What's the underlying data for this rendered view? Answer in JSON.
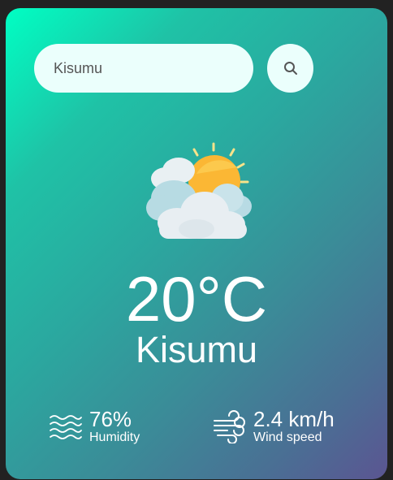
{
  "search": {
    "value": "Kisumu",
    "button_icon": "search-icon"
  },
  "weather": {
    "icon": "partly-cloudy-icon",
    "temperature": "20°C",
    "city": "Kisumu"
  },
  "details": {
    "humidity": {
      "icon": "humidity-waves-icon",
      "value": "76%",
      "label": "Humidity"
    },
    "wind": {
      "icon": "wind-icon",
      "value": "2.4 km/h",
      "label": "Wind speed"
    }
  },
  "colors": {
    "gradient_start": "#00ffc3",
    "gradient_end": "#5b5592",
    "input_bg": "#ebfffc",
    "text": "#ffffff"
  }
}
